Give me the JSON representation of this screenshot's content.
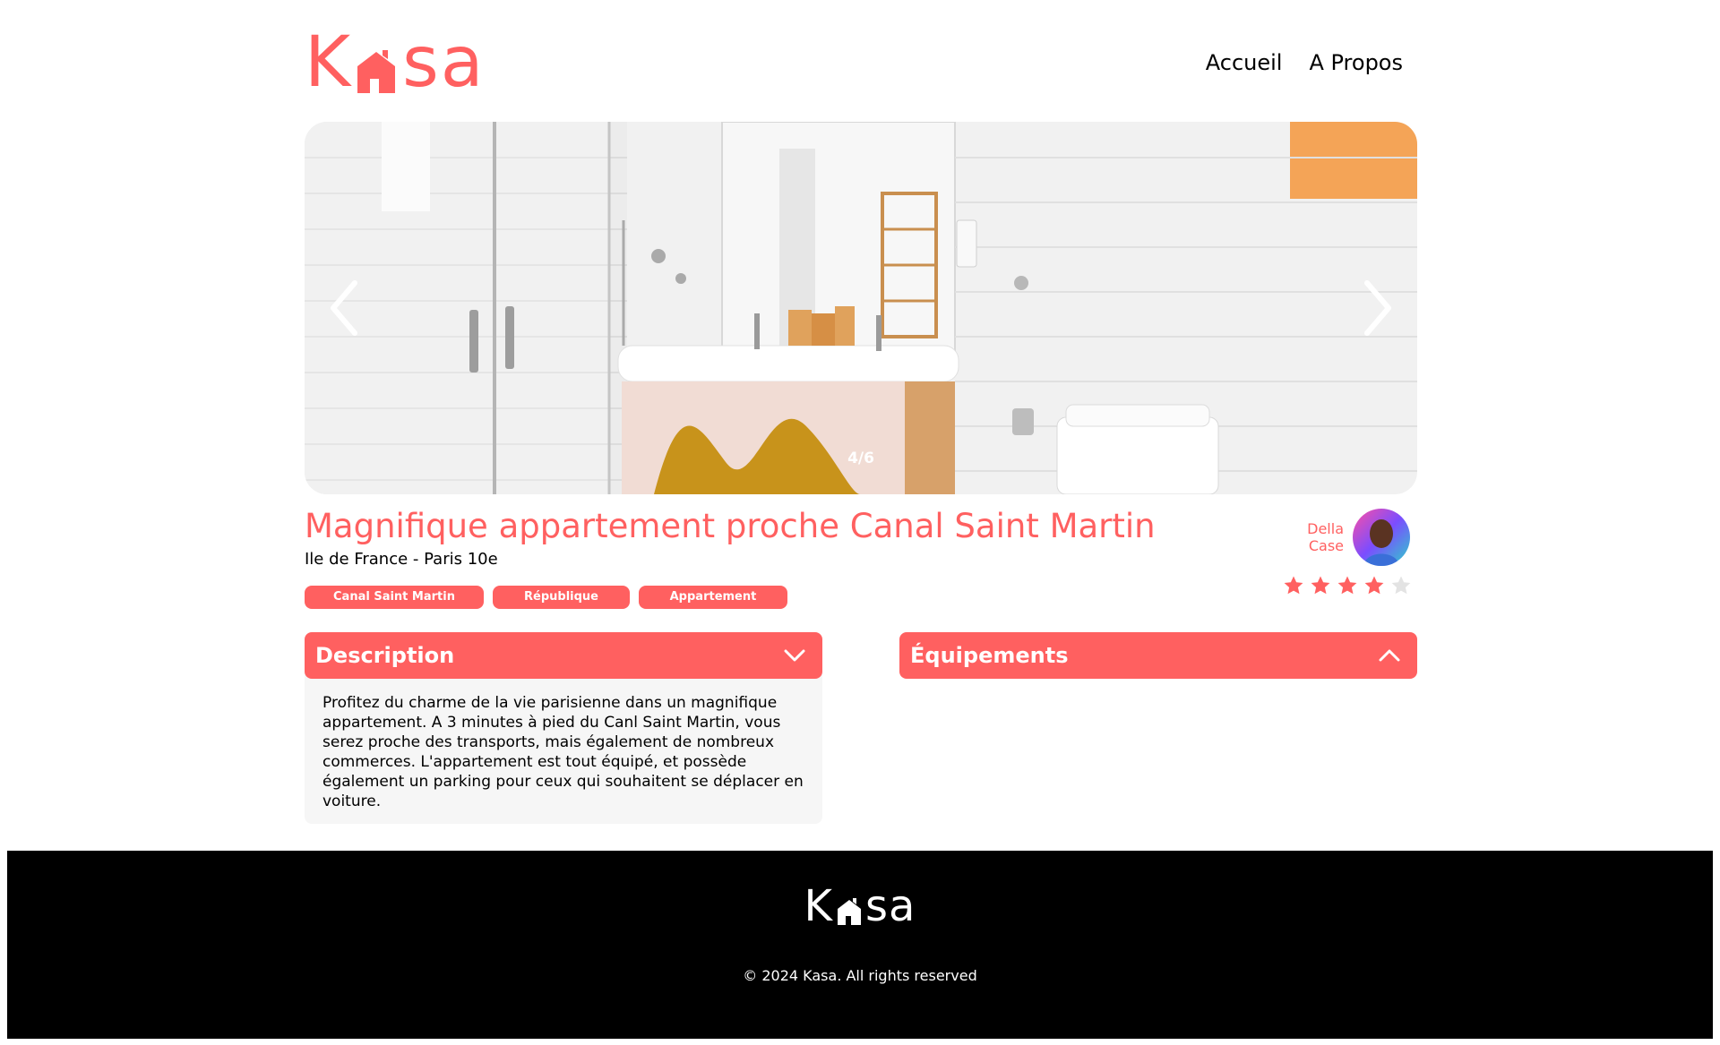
{
  "header": {
    "logo_left": "K",
    "logo_right": "sa",
    "nav": [
      "Accueil",
      "A Propos"
    ]
  },
  "carousel": {
    "counter": "4/6",
    "prev_icon": "chevron-left-icon",
    "next_icon": "chevron-right-icon"
  },
  "listing": {
    "title": "Magnifique appartement proche Canal Saint Martin",
    "location": "Ile de France - Paris 10e",
    "tags": [
      "Canal Saint Martin",
      "République",
      "Appartement"
    ],
    "host_first": "Della",
    "host_last": "Case",
    "rating": 4,
    "rating_max": 5
  },
  "collapses": {
    "description": {
      "title": "Description",
      "body": "Profitez du charme de la vie parisienne dans un magnifique appartement. A 3 minutes à pied du Canl Saint Martin, vous serez proche des transports, mais également de nombreux commerces. L'appartement est tout équipé, et possède également un parking pour ceux qui souhaitent se déplacer en voiture."
    },
    "equipements": {
      "title": "Équipements"
    }
  },
  "footer": {
    "logo_left": "K",
    "logo_right": "sa",
    "copyright": "© 2024 Kasa. All rights reserved"
  },
  "colors": {
    "accent": "#FF6060",
    "panel": "#F6F6F6",
    "star_off": "#E3E3E3",
    "footer_bg": "#000000"
  }
}
